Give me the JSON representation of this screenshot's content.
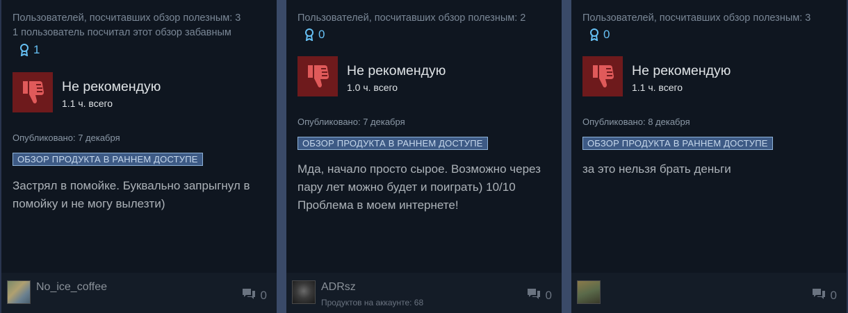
{
  "reviews": [
    {
      "helpful_text": "Пользователей, посчитавших обзор полезным: 3",
      "funny_text": "1 пользователь посчитал этот обзор забавным",
      "award_count": "1",
      "verdict": "Не рекомендую",
      "hours": "1.1 ч. всего",
      "posted": "Опубликовано: 7 декабря",
      "early_access_badge": "ОБЗОР ПРОДУКТА В РАННЕМ ДОСТУПЕ",
      "review_text": "Застрял в помойке. Буквально запрыгнул в помойку и не могу вылезти)",
      "author": "No_ice_coffee",
      "products": "",
      "comment_count": "0"
    },
    {
      "helpful_text": "Пользователей, посчитавших обзор полезным: 2",
      "funny_text": "",
      "award_count": "0",
      "verdict": "Не рекомендую",
      "hours": "1.0 ч. всего",
      "posted": "Опубликовано: 7 декабря",
      "early_access_badge": "ОБЗОР ПРОДУКТА В РАННЕМ ДОСТУПЕ",
      "review_text": "Мда, начало просто сырое. Возможно через пару лет можно будет и поиграть) 10/10 Проблема в моем интернете!",
      "author": "ADRsz",
      "products": "Продуктов на аккаунте: 68",
      "comment_count": "0"
    },
    {
      "helpful_text": "Пользователей, посчитавших обзор полезным: 3",
      "funny_text": "",
      "award_count": "0",
      "verdict": "Не рекомендую",
      "hours": "1.1 ч. всего",
      "posted": "Опубликовано: 8 декабря",
      "early_access_badge": "ОБЗОР ПРОДУКТА В РАННЕМ ДОСТУПЕ",
      "review_text": "за это нельзя брать деньги",
      "author": "",
      "products": "",
      "comment_count": "0"
    }
  ],
  "colors": {
    "thumb_bg": "#6e1a1c",
    "thumb_icon": "#e05a5a",
    "award": "#66c0f4",
    "badge_bg": "#3d5a85"
  }
}
